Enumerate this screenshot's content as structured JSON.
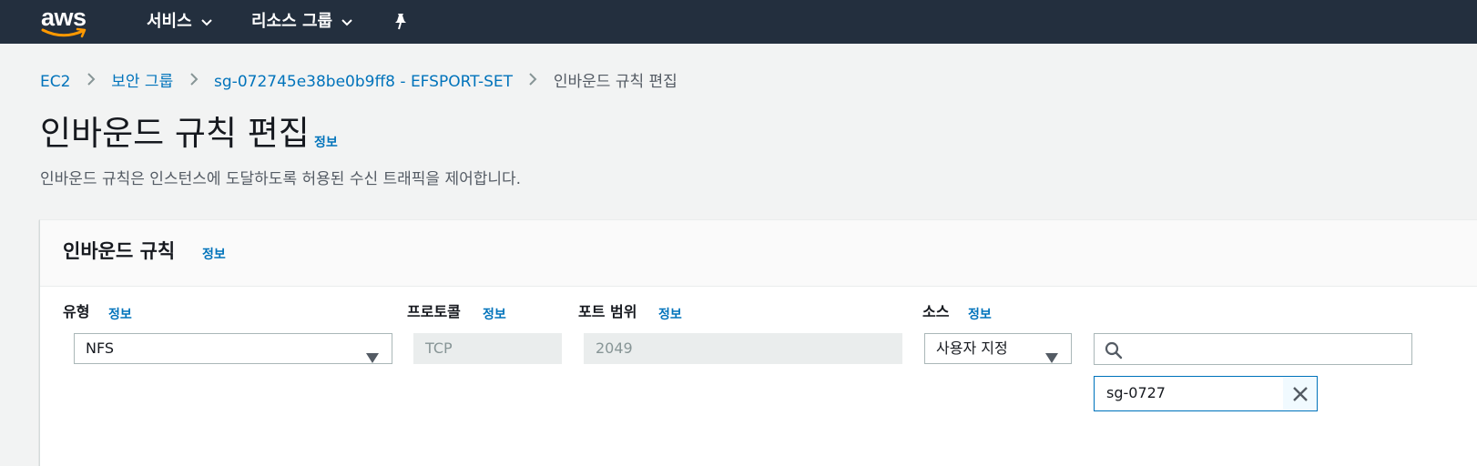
{
  "nav": {
    "logo_text": "aws",
    "services_label": "서비스",
    "resource_groups_label": "리소스 그룹"
  },
  "breadcrumb": {
    "items": [
      "EC2",
      "보안 그룹",
      "sg-072745e38be0b9ff8 - EFSPORT-SET"
    ],
    "current": "인바운드 규칙 편집"
  },
  "page": {
    "title": "인바운드 규칙 편집",
    "info": "정보",
    "description": "인바운드 규칙은 인스턴스에 도달하도록 허용된 수신 트래픽을 제어합니다."
  },
  "panel": {
    "title": "인바운드 규칙",
    "info": "정보"
  },
  "rule": {
    "type_label": "유형",
    "protocol_label": "프로토콜",
    "port_range_label": "포트 범위",
    "source_label": "소스",
    "info": "정보",
    "type_value": "NFS",
    "protocol_value": "TCP",
    "port_range_value": "2049",
    "source_value": "사용자 지정",
    "search_value": "",
    "token_value": "sg-0727"
  },
  "colors": {
    "nav_bg": "#232f3e",
    "link": "#0073bb",
    "page_bg": "#f2f3f3",
    "logo_smile": "#ff9900"
  },
  "icons": [
    "chevron-down-icon",
    "pin-icon",
    "chevron-right-icon",
    "caret-down-icon",
    "search-icon",
    "close-icon"
  ]
}
